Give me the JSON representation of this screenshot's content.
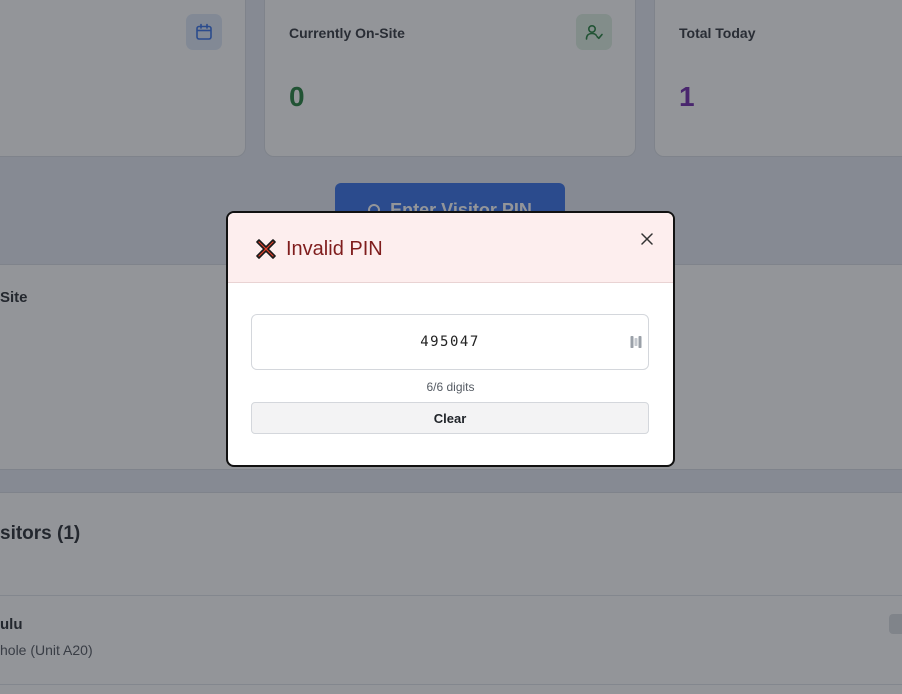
{
  "stats": {
    "card1": {
      "label": "",
      "icon": "calendar-icon",
      "value": ""
    },
    "card2": {
      "label": "Currently On-Site",
      "icon": "user-check-icon",
      "value": "0",
      "value_color": "#1a7a35"
    },
    "card3": {
      "label": "Total Today",
      "value": "1",
      "value_color": "#6b21a8"
    }
  },
  "actions": {
    "enter_pin_label": "Enter Visitor PIN",
    "enter_pin_icon": "pin-icon",
    "accent_color": "#2e6be6"
  },
  "onsite_panel": {
    "title": "Site"
  },
  "visitors_panel": {
    "title": "sitors (1)",
    "rows": [
      {
        "name": "ulu",
        "detail": "hole (Unit A20)"
      }
    ]
  },
  "modal": {
    "title": "Invalid PIN",
    "title_icon": "x-mark-icon",
    "close_icon": "close-icon",
    "pin_value": "495047",
    "pin_icon": "keypad-icon",
    "digit_count": "6/6 digits",
    "clear_label": "Clear",
    "error_color": "#7f1d1d"
  }
}
